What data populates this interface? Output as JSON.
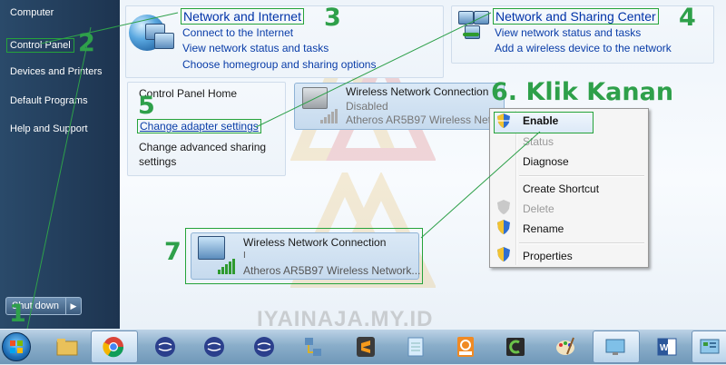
{
  "start_menu": {
    "items": [
      "Computer",
      "Control Panel",
      "Devices and Printers",
      "Default Programs",
      "Help and Support"
    ],
    "shutdown_label": "Shut down"
  },
  "network_internet": {
    "title": "Network and Internet",
    "links": [
      "Connect to the Internet",
      "View network status and tasks",
      "Choose homegroup and sharing options"
    ]
  },
  "sharing_center": {
    "title": "Network and Sharing Center",
    "links": [
      "View network status and tasks",
      "Add a wireless device to the network"
    ]
  },
  "left_nav": {
    "home": "Control Panel Home",
    "change_adapter": "Change adapter settings",
    "change_advanced_line1": "Change advanced sharing",
    "change_advanced_line2": "settings"
  },
  "adapter_top": {
    "name": "Wireless Network Connection",
    "status": "Disabled",
    "device": "Atheros AR5B97 Wireless Netw"
  },
  "adapter_bottom": {
    "name": "Wireless Network Connection",
    "status": "I",
    "device": "Atheros AR5B97 Wireless Network..."
  },
  "context_menu": {
    "items": [
      {
        "label": "Enable",
        "enabled": true,
        "shield": true
      },
      {
        "label": "Status",
        "enabled": false,
        "shield": false
      },
      {
        "label": "Diagnose",
        "enabled": true,
        "shield": false
      },
      {
        "label": "Create Shortcut",
        "enabled": true,
        "shield": false
      },
      {
        "label": "Delete",
        "enabled": false,
        "shield": true
      },
      {
        "label": "Rename",
        "enabled": true,
        "shield": true
      },
      {
        "label": "Properties",
        "enabled": true,
        "shield": true
      }
    ]
  },
  "annotations": {
    "n1": "1",
    "n2": "2",
    "n3": "3",
    "n4": "4",
    "n5": "5",
    "n6": "6. Klik Kanan",
    "n7": "7"
  },
  "watermark": "IYAINAJA.MY.ID",
  "taskbar": {
    "icons": [
      "start-orb-icon",
      "file-explorer-icon",
      "chrome-icon",
      "eclipse-icon",
      "eclipse-icon",
      "eclipse-icon",
      "network-tool-icon",
      "sublime-text-icon",
      "notepad-icon",
      "pdf-icon",
      "camtasia-icon",
      "paint-icon",
      "desktop-icon",
      "word-icon",
      "control-panel-icon"
    ]
  },
  "colors": {
    "annotation_green": "#2ea04a",
    "link_blue": "#0a3da8",
    "start_menu_bg": "#1d3450"
  }
}
